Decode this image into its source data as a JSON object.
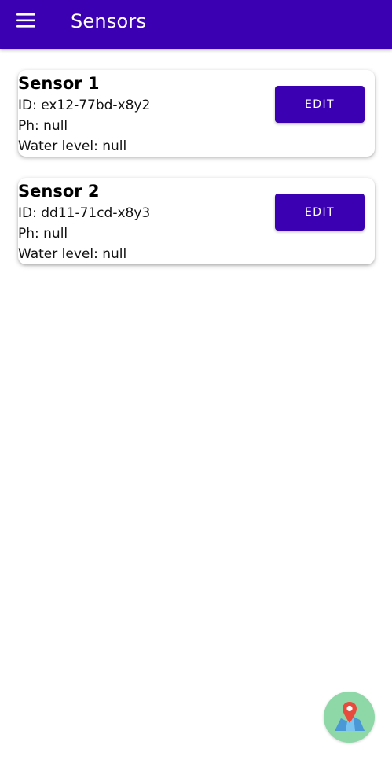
{
  "appbar": {
    "title": "Sensors",
    "menu_icon": "hamburger-menu-icon",
    "background_color": "#3a00b2"
  },
  "sensors": [
    {
      "name": "Sensor 1",
      "id_line": "ID: ex12-77bd-x8y2",
      "ph_line": "Ph: null",
      "water_line": "Water level: null",
      "edit_label": "EDIT"
    },
    {
      "name": "Sensor 2",
      "id_line": "ID: dd11-71cd-x8y3",
      "ph_line": "Ph: null",
      "water_line": "Water level: null",
      "edit_label": "EDIT"
    }
  ],
  "fab": {
    "icon": "map-pin-icon",
    "background_color": "#8ed8a8"
  }
}
